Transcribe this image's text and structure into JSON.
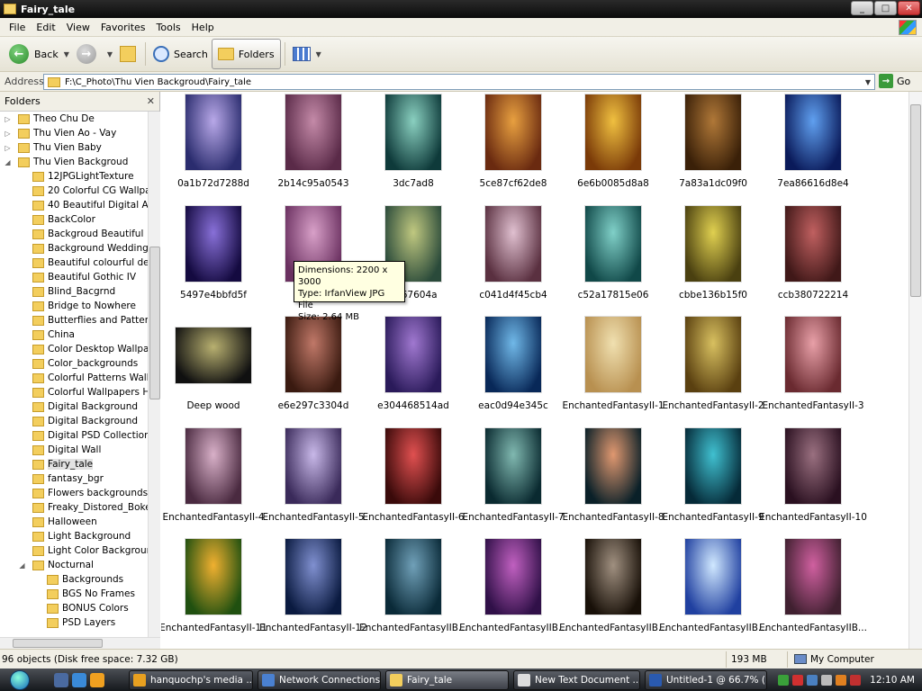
{
  "window": {
    "title": "Fairy_tale"
  },
  "menu": [
    "File",
    "Edit",
    "View",
    "Favorites",
    "Tools",
    "Help"
  ],
  "toolbar": {
    "back": "Back",
    "search": "Search",
    "folders": "Folders"
  },
  "address": {
    "label": "Address",
    "path": "F:\\C_Photo\\Thu Vien Backgroud\\Fairy_tale",
    "go": "Go"
  },
  "folders_pane": {
    "title": "Folders",
    "items": [
      {
        "label": "Theo Chu De",
        "level": 0,
        "exp": "▷"
      },
      {
        "label": "Thu Vien Ao - Vay",
        "level": 0,
        "exp": "▷"
      },
      {
        "label": "Thu Vien Baby",
        "level": 0,
        "exp": "▷"
      },
      {
        "label": "Thu Vien Backgroud",
        "level": 0,
        "exp": "◢"
      },
      {
        "label": "12JPGLightTexture",
        "level": 1,
        "exp": ""
      },
      {
        "label": "20 Colorful CG Wallpap",
        "level": 1,
        "exp": ""
      },
      {
        "label": "40 Beautiful Digital Art",
        "level": 1,
        "exp": ""
      },
      {
        "label": "BackColor",
        "level": 1,
        "exp": ""
      },
      {
        "label": "Backgroud Beautiful",
        "level": 1,
        "exp": ""
      },
      {
        "label": "Background Wedding",
        "level": 1,
        "exp": ""
      },
      {
        "label": "Beautiful colourful desi",
        "level": 1,
        "exp": ""
      },
      {
        "label": "Beautiful Gothic IV",
        "level": 1,
        "exp": ""
      },
      {
        "label": "Blind_Bacgrnd",
        "level": 1,
        "exp": ""
      },
      {
        "label": "Bridge to Nowhere",
        "level": 1,
        "exp": ""
      },
      {
        "label": "Butterflies and Patterns",
        "level": 1,
        "exp": ""
      },
      {
        "label": "China",
        "level": 1,
        "exp": ""
      },
      {
        "label": "Color Desktop Wallpap",
        "level": 1,
        "exp": ""
      },
      {
        "label": "Color_backgrounds",
        "level": 1,
        "exp": ""
      },
      {
        "label": "Colorful Patterns Wall",
        "level": 1,
        "exp": ""
      },
      {
        "label": "Colorful Wallpapers HD",
        "level": 1,
        "exp": ""
      },
      {
        "label": "Digital Background",
        "level": 1,
        "exp": ""
      },
      {
        "label": "Digital Background",
        "level": 1,
        "exp": ""
      },
      {
        "label": "Digital PSD Collection N",
        "level": 1,
        "exp": ""
      },
      {
        "label": "Digital Wall",
        "level": 1,
        "exp": ""
      },
      {
        "label": "Fairy_tale",
        "level": 1,
        "exp": "",
        "selected": true
      },
      {
        "label": "fantasy_bgr",
        "level": 1,
        "exp": ""
      },
      {
        "label": "Flowers backgrounds",
        "level": 1,
        "exp": ""
      },
      {
        "label": "Freaky_Distored_Bokeh",
        "level": 1,
        "exp": ""
      },
      {
        "label": "Halloween",
        "level": 1,
        "exp": ""
      },
      {
        "label": "Light Background",
        "level": 1,
        "exp": ""
      },
      {
        "label": "Light Color Background",
        "level": 1,
        "exp": ""
      },
      {
        "label": "Nocturnal",
        "level": 1,
        "exp": "◢"
      },
      {
        "label": "Backgrounds",
        "level": 2,
        "exp": ""
      },
      {
        "label": "BGS No Frames",
        "level": 2,
        "exp": ""
      },
      {
        "label": "BONUS Colors",
        "level": 2,
        "exp": ""
      },
      {
        "label": "PSD Layers",
        "level": 2,
        "exp": ""
      }
    ]
  },
  "files": [
    {
      "name": "0a1b72d7288d",
      "c1": "#2a2c6e",
      "c2": "#b8a8e8"
    },
    {
      "name": "2b14c95a0543",
      "c1": "#5a2a48",
      "c2": "#c48aa8"
    },
    {
      "name": "3dc7ad8",
      "c1": "#0e3a3a",
      "c2": "#8ad0c0"
    },
    {
      "name": "5ce87cf62de8",
      "c1": "#6a2a10",
      "c2": "#e8a040"
    },
    {
      "name": "6e6b0085d8a8",
      "c1": "#7a3a08",
      "c2": "#f0c040"
    },
    {
      "name": "7a83a1dc09f0",
      "c1": "#3a2008",
      "c2": "#b07838"
    },
    {
      "name": "7ea86616d8e4",
      "c1": "#0a1a5a",
      "c2": "#60a0f0"
    },
    {
      "name": "5497e4bbfd5f",
      "c1": "#140a40",
      "c2": "#8870d8"
    },
    {
      "name": "84",
      "c1": "#6a3060",
      "c2": "#d8a0c8"
    },
    {
      "name": "9867604a",
      "c1": "#2a4a3a",
      "c2": "#c0c880"
    },
    {
      "name": "c041d4f45cb4",
      "c1": "#5a3040",
      "c2": "#e0c0d0"
    },
    {
      "name": "c52a17815e06",
      "c1": "#104848",
      "c2": "#80d0c8"
    },
    {
      "name": "cbbe136b15f0",
      "c1": "#4a4010",
      "c2": "#e0d050"
    },
    {
      "name": "ccb380722214",
      "c1": "#401818",
      "c2": "#c06060"
    },
    {
      "name": "Deep wood",
      "c1": "#101010",
      "c2": "#b8b070",
      "wide": true
    },
    {
      "name": "e6e297c3304d",
      "c1": "#3a1a10",
      "c2": "#c07868"
    },
    {
      "name": "e304468514ad",
      "c1": "#2a1a5a",
      "c2": "#a078d0"
    },
    {
      "name": "eac0d94e345c",
      "c1": "#082858",
      "c2": "#70b8e8"
    },
    {
      "name": "EnchantedFantasyII-1",
      "c1": "#b89050",
      "c2": "#f0e0b0"
    },
    {
      "name": "EnchantedFantasyII-2",
      "c1": "#5a4010",
      "c2": "#d8c060"
    },
    {
      "name": "EnchantedFantasyII-3",
      "c1": "#6a2a30",
      "c2": "#e8a0a8"
    },
    {
      "name": "EnchantedFantasyII-4",
      "c1": "#4a2a40",
      "c2": "#d8b0c8"
    },
    {
      "name": "EnchantedFantasyII-5",
      "c1": "#3a2a5a",
      "c2": "#c8b8e8"
    },
    {
      "name": "EnchantedFantasyII-6",
      "c1": "#3a0a0a",
      "c2": "#e05050"
    },
    {
      "name": "EnchantedFantasyII-7",
      "c1": "#0a2a30",
      "c2": "#80b8b0"
    },
    {
      "name": "EnchantedFantasyII-8",
      "c1": "#0a2028",
      "c2": "#e09870"
    },
    {
      "name": "EnchantedFantasyII-9",
      "c1": "#052a38",
      "c2": "#40c0d0"
    },
    {
      "name": "EnchantedFantasyII-10",
      "c1": "#2a1020",
      "c2": "#9a7080"
    },
    {
      "name": "EnchantedFantasyII-11",
      "c1": "#205010",
      "c2": "#f0b030"
    },
    {
      "name": "EnchantedFantasyII-12",
      "c1": "#0a1a40",
      "c2": "#8090d0"
    },
    {
      "name": "EnchantedFantasyIIB...",
      "c1": "#0a2a38",
      "c2": "#70a0b8"
    },
    {
      "name": "EnchantedFantasyIIB...",
      "c1": "#301048",
      "c2": "#c060c0"
    },
    {
      "name": "EnchantedFantasyIIB...",
      "c1": "#181008",
      "c2": "#a09080"
    },
    {
      "name": "EnchantedFantasyIIB...",
      "c1": "#2040a0",
      "c2": "#d0e8ff"
    },
    {
      "name": "EnchantedFantasyIIB...",
      "c1": "#402030",
      "c2": "#d060a0"
    }
  ],
  "tooltip": {
    "line1": "Dimensions: 2200 x 3000",
    "line2": "Type: IrfanView JPG File",
    "line3": "Size: 2.64 MB"
  },
  "status": {
    "objects": "96 objects (Disk free space: 7.32 GB)",
    "size": "193 MB",
    "location": "My Computer"
  },
  "taskbar": {
    "tasks": [
      {
        "label": "hanquochp's media ...",
        "color": "#e8a020"
      },
      {
        "label": "Network Connections",
        "color": "#4a80d0"
      },
      {
        "label": "Fairy_tale",
        "color": "#f3ce5d",
        "active": true
      },
      {
        "label": "New Text Document ...",
        "color": "#dddddd"
      },
      {
        "label": "Untitled-1 @ 66.7% (...",
        "color": "#2a5ab0"
      }
    ],
    "clock": "12:10 AM"
  }
}
